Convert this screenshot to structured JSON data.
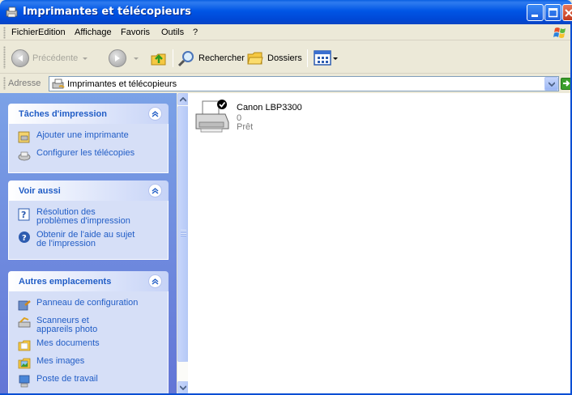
{
  "window": {
    "title": "Imprimantes et télécopieurs"
  },
  "menu": {
    "items": [
      "Fichier",
      "Edition",
      "Affichage",
      "Favoris",
      "Outils",
      "?"
    ]
  },
  "toolbar": {
    "back_label": "Précédente",
    "search_label": "Rechercher",
    "folders_label": "Dossiers"
  },
  "address": {
    "label": "Adresse",
    "value": "Imprimantes et télécopieurs",
    "go_label": "OK"
  },
  "taskpane": {
    "groups": [
      {
        "title": "Tâches d'impression",
        "tasks": [
          {
            "label": "Ajouter une imprimante",
            "icon": "add-printer-icon"
          },
          {
            "label": "Configurer les télécopies",
            "icon": "fax-icon"
          }
        ]
      },
      {
        "title": "Voir aussi",
        "tasks": [
          {
            "label": "Résolution des problèmes d'impression",
            "icon": "help-book-icon"
          },
          {
            "label": "Obtenir de l'aide au sujet de l'impression",
            "icon": "help-circle-icon"
          }
        ]
      },
      {
        "title": "Autres emplacements",
        "tasks": [
          {
            "label": "Panneau de configuration",
            "icon": "control-panel-icon"
          },
          {
            "label": "Scanneurs et appareils photo",
            "icon": "scanner-icon"
          },
          {
            "label": "Mes documents",
            "icon": "my-documents-icon"
          },
          {
            "label": "Mes images",
            "icon": "my-pictures-icon"
          },
          {
            "label": "Poste de travail",
            "icon": "my-computer-icon"
          }
        ]
      }
    ]
  },
  "printers": [
    {
      "name": "Canon LBP3300",
      "documents": "0",
      "status": "Prêt",
      "default": true
    }
  ],
  "colors": {
    "titlebar": "#0055e5",
    "task_link": "#215dc6",
    "pane_background": "#7ba2e7"
  }
}
